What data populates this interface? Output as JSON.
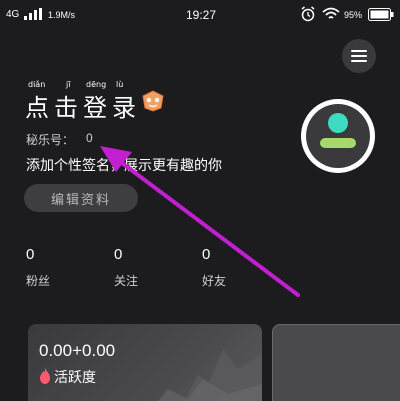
{
  "status_bar": {
    "network": "4G",
    "speed": "1.9M/s",
    "time": "19:27",
    "battery": "95%"
  },
  "profile": {
    "login_title": "点击登录",
    "pinyin": [
      "diǎn",
      "jī",
      "dēng",
      "lù"
    ],
    "account_label": "秘乐号：",
    "account_value": "0",
    "bio": "添加个性签名，展示更有趣的你",
    "edit_button": "编辑资料"
  },
  "stats": [
    {
      "value": "0",
      "label": "粉丝"
    },
    {
      "value": "0",
      "label": "关注"
    },
    {
      "value": "0",
      "label": "好友"
    }
  ],
  "card": {
    "value": "0.00+0.00",
    "label": "活跃度"
  },
  "icons": {
    "menu": "hamburger-menu-icon",
    "badge": "level-badge-icon",
    "avatar": "default-avatar-icon",
    "flame": "flame-icon"
  },
  "colors": {
    "background": "#1c1c1e",
    "avatar_head": "#3ddbc1",
    "avatar_body": "#a6d86e",
    "flame": "#ff5a6e",
    "badge": "#f0a060",
    "arrow": "#c21fd1"
  }
}
